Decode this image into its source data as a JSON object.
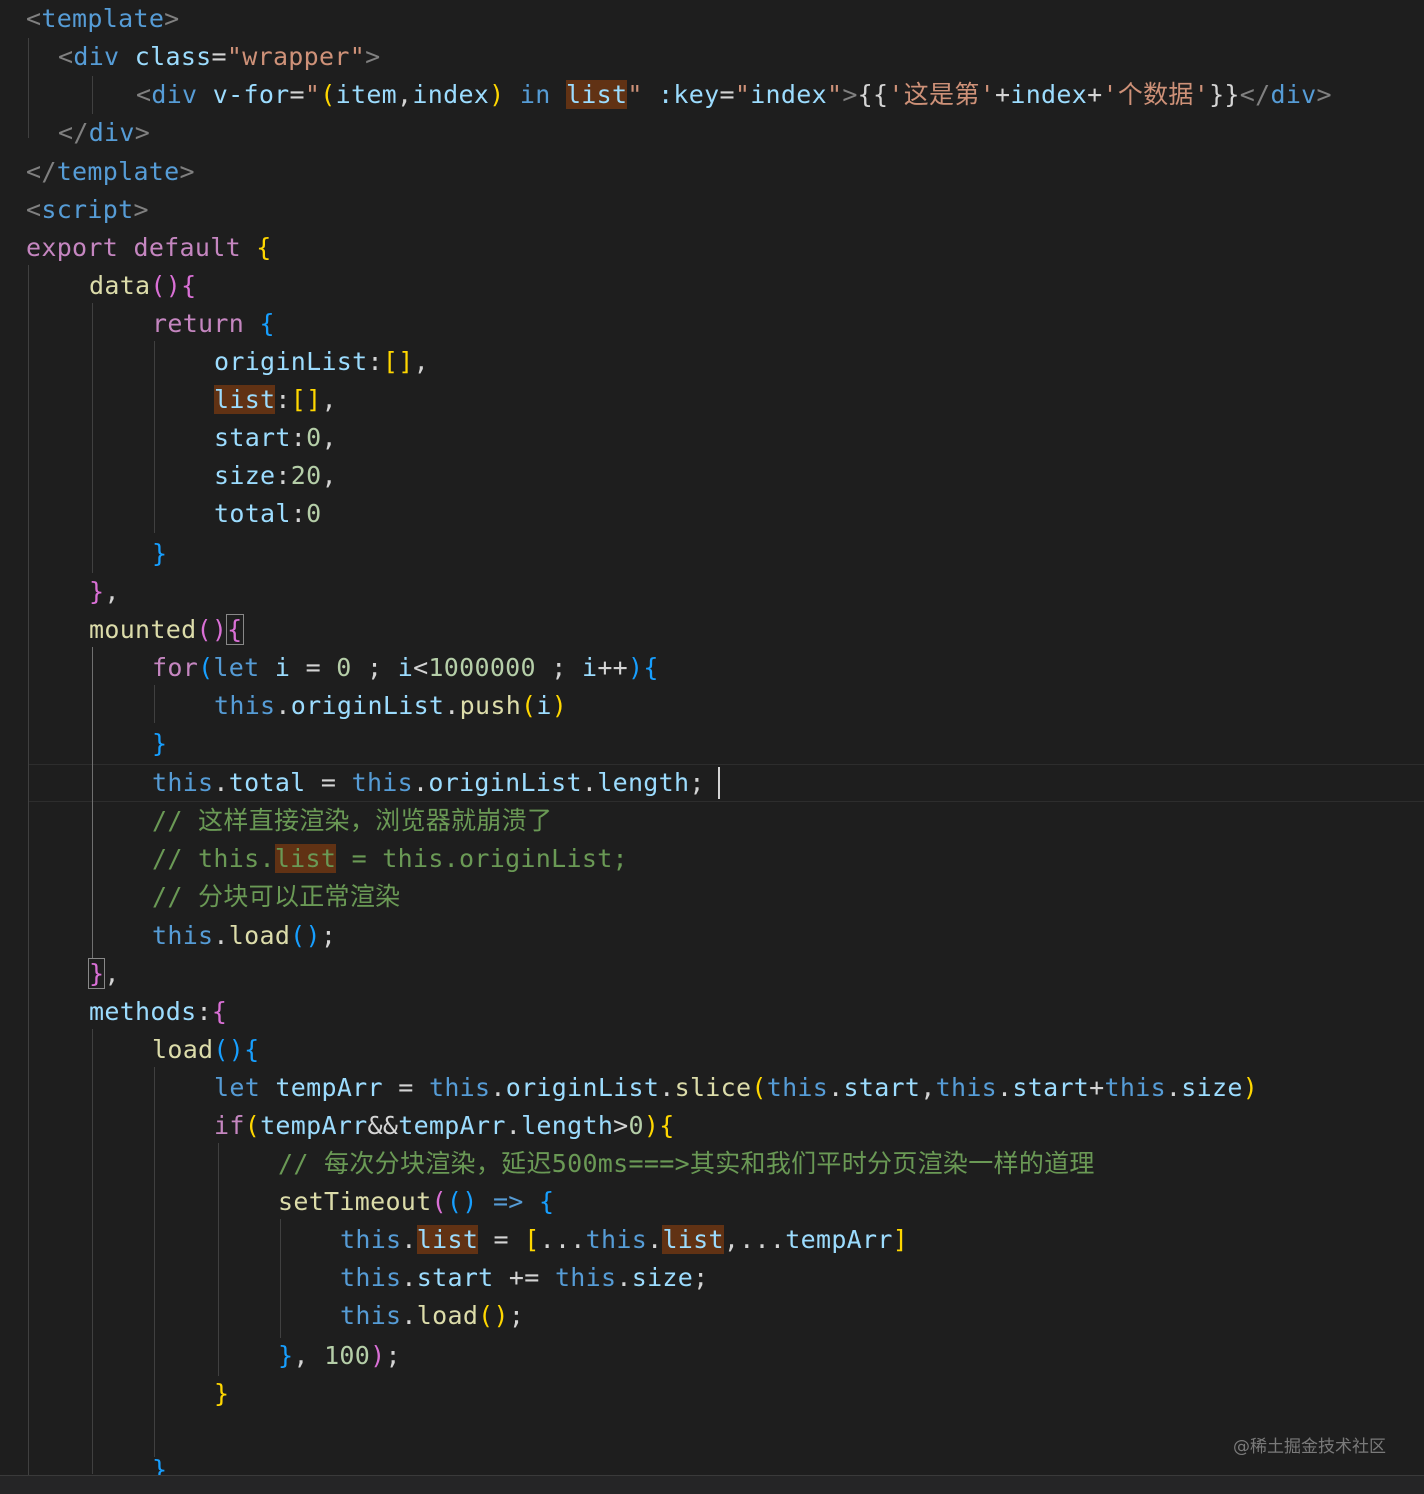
{
  "editor": {
    "language": "vue",
    "theme_colors": {
      "background": "#1e1e1e",
      "keyword": "#c586c0",
      "storage": "#569cd6",
      "variable": "#9cdcfe",
      "function": "#dcdcaa",
      "string": "#ce9178",
      "number": "#b5cea8",
      "comment": "#6a9955",
      "highlight": "#613214"
    },
    "lines": [
      [
        [
          "t-tag",
          "<"
        ],
        [
          "t-tagn",
          "template"
        ],
        [
          "t-tag",
          ">"
        ]
      ],
      [
        [
          "t-tag",
          "<"
        ],
        [
          "t-tagn",
          "div"
        ],
        [
          "t-p",
          " "
        ],
        [
          "t-attr",
          "class"
        ],
        [
          "t-p",
          "="
        ],
        [
          "t-str",
          "\"wrapper\""
        ],
        [
          "t-tag",
          ">"
        ]
      ],
      [
        [
          "t-tag",
          "<"
        ],
        [
          "t-tagn",
          "div"
        ],
        [
          "t-p",
          " "
        ],
        [
          "t-attr",
          "v-for"
        ],
        [
          "t-p",
          "="
        ],
        [
          "t-str",
          "\""
        ],
        [
          "t-b1",
          "("
        ],
        [
          "t-var",
          "item"
        ],
        [
          "t-p",
          ","
        ],
        [
          "t-var",
          "index"
        ],
        [
          "t-b1",
          ")"
        ],
        [
          "t-p",
          " "
        ],
        [
          "t-st",
          "in"
        ],
        [
          "t-p",
          " "
        ],
        [
          "t-var t-hl",
          "list"
        ],
        [
          "t-str",
          "\""
        ],
        [
          "t-p",
          " "
        ],
        [
          "t-attr",
          ":key"
        ],
        [
          "t-p",
          "="
        ],
        [
          "t-str",
          "\""
        ],
        [
          "t-var",
          "index"
        ],
        [
          "t-str",
          "\""
        ],
        [
          "t-tag",
          ">"
        ],
        [
          "t-p",
          "{{"
        ],
        [
          "t-str",
          "'这是第'"
        ],
        [
          "t-op",
          "+"
        ],
        [
          "t-var",
          "index"
        ],
        [
          "t-op",
          "+"
        ],
        [
          "t-str",
          "'个数据'"
        ],
        [
          "t-p",
          "}}"
        ],
        [
          "t-tag",
          "</"
        ],
        [
          "t-tagn",
          "div"
        ],
        [
          "t-tag",
          ">"
        ]
      ],
      [
        [
          "t-tag",
          "</"
        ],
        [
          "t-tagn",
          "div"
        ],
        [
          "t-tag",
          ">"
        ]
      ],
      [
        [
          "t-tag",
          "</"
        ],
        [
          "t-tagn",
          "template"
        ],
        [
          "t-tag",
          ">"
        ]
      ],
      [
        [
          "t-tag",
          "<"
        ],
        [
          "t-tagn",
          "script"
        ],
        [
          "t-tag",
          ">"
        ]
      ],
      [
        [
          "t-kw",
          "export"
        ],
        [
          "t-p",
          " "
        ],
        [
          "t-kw",
          "default"
        ],
        [
          "t-p",
          " "
        ],
        [
          "t-b1",
          "{"
        ]
      ],
      [
        [
          "t-fn",
          "data"
        ],
        [
          "t-b2",
          "()"
        ],
        [
          "t-b2",
          "{"
        ]
      ],
      [
        [
          "t-kw",
          "return"
        ],
        [
          "t-p",
          " "
        ],
        [
          "t-b3",
          "{"
        ]
      ],
      [
        [
          "t-var",
          "originList"
        ],
        [
          "t-p",
          ":"
        ],
        [
          "t-b1",
          "[]"
        ],
        [
          "t-p",
          ","
        ]
      ],
      [
        [
          "t-var t-hl",
          "list"
        ],
        [
          "t-p",
          ":"
        ],
        [
          "t-b1",
          "[]"
        ],
        [
          "t-p",
          ","
        ]
      ],
      [
        [
          "t-var",
          "start"
        ],
        [
          "t-p",
          ":"
        ],
        [
          "t-num",
          "0"
        ],
        [
          "t-p",
          ","
        ]
      ],
      [
        [
          "t-var",
          "size"
        ],
        [
          "t-p",
          ":"
        ],
        [
          "t-num",
          "20"
        ],
        [
          "t-p",
          ","
        ]
      ],
      [
        [
          "t-var",
          "total"
        ],
        [
          "t-p",
          ":"
        ],
        [
          "t-num",
          "0"
        ]
      ],
      [
        [
          "t-b3",
          "}"
        ]
      ],
      [
        [
          "t-b2",
          "}"
        ],
        [
          "t-p",
          ","
        ]
      ],
      [
        [
          "t-fn",
          "mounted"
        ],
        [
          "t-b2",
          "()"
        ],
        [
          "t-b2 t-box",
          "{"
        ]
      ],
      [
        [
          "t-kw",
          "for"
        ],
        [
          "t-b3",
          "("
        ],
        [
          "t-st",
          "let"
        ],
        [
          "t-p",
          " "
        ],
        [
          "t-var",
          "i"
        ],
        [
          "t-p",
          " "
        ],
        [
          "t-op",
          "="
        ],
        [
          "t-p",
          " "
        ],
        [
          "t-num",
          "0"
        ],
        [
          "t-p",
          " ; "
        ],
        [
          "t-var",
          "i"
        ],
        [
          "t-op",
          "<"
        ],
        [
          "t-num",
          "1000000"
        ],
        [
          "t-p",
          " ; "
        ],
        [
          "t-var",
          "i"
        ],
        [
          "t-op",
          "++"
        ],
        [
          "t-b3",
          ")"
        ],
        [
          "t-b3",
          "{"
        ]
      ],
      [
        [
          "t-st",
          "this"
        ],
        [
          "t-p",
          "."
        ],
        [
          "t-prop",
          "originList"
        ],
        [
          "t-p",
          "."
        ],
        [
          "t-fn",
          "push"
        ],
        [
          "t-b1",
          "("
        ],
        [
          "t-var",
          "i"
        ],
        [
          "t-b1",
          ")"
        ]
      ],
      [
        [
          "t-b3",
          "}"
        ]
      ],
      [
        [
          "t-st",
          "this"
        ],
        [
          "t-p",
          "."
        ],
        [
          "t-prop",
          "total"
        ],
        [
          "t-p",
          " "
        ],
        [
          "t-op",
          "="
        ],
        [
          "t-p",
          " "
        ],
        [
          "t-st",
          "this"
        ],
        [
          "t-p",
          "."
        ],
        [
          "t-prop",
          "originList"
        ],
        [
          "t-p",
          "."
        ],
        [
          "t-prop",
          "length"
        ],
        [
          "t-p",
          ";"
        ]
      ],
      [
        [
          "t-cmt",
          "// 这样直接渲染，浏览器就崩溃了"
        ]
      ],
      [
        [
          "t-cmt",
          "// this."
        ],
        [
          "t-cmt t-hl",
          "list"
        ],
        [
          "t-cmt",
          " = this.originList;"
        ]
      ],
      [
        [
          "t-cmt",
          "// 分块可以正常渲染"
        ]
      ],
      [
        [
          "t-st",
          "this"
        ],
        [
          "t-p",
          "."
        ],
        [
          "t-fn",
          "load"
        ],
        [
          "t-b3",
          "()"
        ],
        [
          "t-p",
          ";"
        ]
      ],
      [
        [
          "t-b2 t-box",
          "}"
        ],
        [
          "t-p",
          ","
        ]
      ],
      [
        [
          "t-var",
          "methods"
        ],
        [
          "t-p",
          ":"
        ],
        [
          "t-b2",
          "{"
        ]
      ],
      [
        [
          "t-fn",
          "load"
        ],
        [
          "t-b3",
          "()"
        ],
        [
          "t-b3",
          "{"
        ]
      ],
      [
        [
          "t-st",
          "let"
        ],
        [
          "t-p",
          " "
        ],
        [
          "t-var",
          "tempArr"
        ],
        [
          "t-p",
          " "
        ],
        [
          "t-op",
          "="
        ],
        [
          "t-p",
          " "
        ],
        [
          "t-st",
          "this"
        ],
        [
          "t-p",
          "."
        ],
        [
          "t-prop",
          "originList"
        ],
        [
          "t-p",
          "."
        ],
        [
          "t-fn",
          "slice"
        ],
        [
          "t-b1",
          "("
        ],
        [
          "t-st",
          "this"
        ],
        [
          "t-p",
          "."
        ],
        [
          "t-prop",
          "start"
        ],
        [
          "t-p",
          ","
        ],
        [
          "t-st",
          "this"
        ],
        [
          "t-p",
          "."
        ],
        [
          "t-prop",
          "start"
        ],
        [
          "t-op",
          "+"
        ],
        [
          "t-st",
          "this"
        ],
        [
          "t-p",
          "."
        ],
        [
          "t-prop",
          "size"
        ],
        [
          "t-b1",
          ")"
        ]
      ],
      [
        [
          "t-kw",
          "if"
        ],
        [
          "t-b1",
          "("
        ],
        [
          "t-var",
          "tempArr"
        ],
        [
          "t-op",
          "&&"
        ],
        [
          "t-var",
          "tempArr"
        ],
        [
          "t-p",
          "."
        ],
        [
          "t-prop",
          "length"
        ],
        [
          "t-op",
          ">"
        ],
        [
          "t-num",
          "0"
        ],
        [
          "t-b1",
          ")"
        ],
        [
          "t-b1",
          "{"
        ]
      ],
      [
        [
          "t-cmt",
          "// 每次分块渲染，延迟500ms===>其实和我们平时分页渲染一样的道理"
        ]
      ],
      [
        [
          "t-fn",
          "setTimeout"
        ],
        [
          "t-b2",
          "("
        ],
        [
          "t-b3",
          "()"
        ],
        [
          "t-p",
          " "
        ],
        [
          "t-st",
          "=>"
        ],
        [
          "t-p",
          " "
        ],
        [
          "t-b3",
          "{"
        ]
      ],
      [
        [
          "t-st",
          "this"
        ],
        [
          "t-p",
          "."
        ],
        [
          "t-prop t-hl",
          "list"
        ],
        [
          "t-p",
          " "
        ],
        [
          "t-op",
          "="
        ],
        [
          "t-p",
          " "
        ],
        [
          "t-b1",
          "["
        ],
        [
          "t-op",
          "..."
        ],
        [
          "t-st",
          "this"
        ],
        [
          "t-p",
          "."
        ],
        [
          "t-prop t-hl",
          "list"
        ],
        [
          "t-p",
          ","
        ],
        [
          "t-op",
          "..."
        ],
        [
          "t-var",
          "tempArr"
        ],
        [
          "t-b1",
          "]"
        ]
      ],
      [
        [
          "t-st",
          "this"
        ],
        [
          "t-p",
          "."
        ],
        [
          "t-prop",
          "start"
        ],
        [
          "t-p",
          " "
        ],
        [
          "t-op",
          "+="
        ],
        [
          "t-p",
          " "
        ],
        [
          "t-st",
          "this"
        ],
        [
          "t-p",
          "."
        ],
        [
          "t-prop",
          "size"
        ],
        [
          "t-p",
          ";"
        ]
      ],
      [
        [
          "t-st",
          "this"
        ],
        [
          "t-p",
          "."
        ],
        [
          "t-fn",
          "load"
        ],
        [
          "t-b1",
          "()"
        ],
        [
          "t-p",
          ";"
        ]
      ],
      [
        [
          "t-b3",
          "}"
        ],
        [
          "t-p",
          ", "
        ],
        [
          "t-num",
          "100"
        ],
        [
          "t-b2",
          ")"
        ],
        [
          "t-p",
          ";"
        ]
      ],
      [
        [
          "t-b1",
          "}"
        ]
      ],
      [],
      [
        [
          "t-b3",
          "}"
        ]
      ]
    ]
  },
  "watermark": "@稀土掘金技术社区"
}
